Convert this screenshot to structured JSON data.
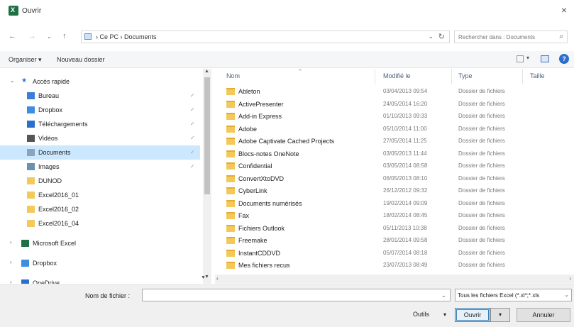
{
  "window": {
    "title": "Ouvrir",
    "close": "×"
  },
  "nav": {
    "back": "←",
    "forward": "→",
    "recent": "⌄",
    "up": "↑",
    "breadcrumb": "›  Ce PC  ›  Documents",
    "address_dropdown": "⌄",
    "refresh": "↻",
    "search_placeholder": "Rechercher dans : Documents",
    "search_icon": "⌕"
  },
  "toolbar": {
    "organize": "Organiser ▾",
    "new_folder": "Nouveau dossier",
    "help": "?"
  },
  "sidebar": {
    "items": [
      {
        "label": "Accès rapide",
        "icon": "star-icon",
        "color": "#2a6fc9",
        "expander": "⌄",
        "pinned": false
      },
      {
        "label": "Bureau",
        "icon": "desktop-icon",
        "color": "#3a7fd5",
        "pinned": true
      },
      {
        "label": "Dropbox",
        "icon": "dropbox-icon",
        "color": "#3d8ee0",
        "pinned": true
      },
      {
        "label": "Téléchargements",
        "icon": "download-icon",
        "color": "#2a6fc9",
        "pinned": true
      },
      {
        "label": "Vidéos",
        "icon": "video-icon",
        "color": "#555555",
        "pinned": true
      },
      {
        "label": "Documents",
        "icon": "documents-icon",
        "color": "#8aa4c0",
        "pinned": true,
        "selected": true
      },
      {
        "label": "Images",
        "icon": "images-icon",
        "color": "#6d8fb0",
        "pinned": true
      },
      {
        "label": "DUNOD",
        "icon": "folder-icon",
        "color": "#f3c95b",
        "pinned": false
      },
      {
        "label": "Excel2016_01",
        "icon": "folder-icon",
        "color": "#f3c95b",
        "pinned": false
      },
      {
        "label": "Excel2016_02",
        "icon": "folder-icon",
        "color": "#f3c95b",
        "pinned": false
      },
      {
        "label": "Excel2016_04",
        "icon": "folder-icon",
        "color": "#f3c95b",
        "pinned": false
      },
      {
        "label": "Microsoft Excel",
        "icon": "excel-icon",
        "color": "#1e7145",
        "expander": "›",
        "pinned": false
      },
      {
        "label": "Dropbox",
        "icon": "dropbox-icon",
        "color": "#3d8ee0",
        "expander": "›",
        "pinned": false
      },
      {
        "label": "OneDrive",
        "icon": "onedrive-icon",
        "color": "#2a6fc9",
        "expander": "›",
        "pinned": false
      }
    ],
    "pin_glyph": "✓"
  },
  "columns": {
    "name": "Nom",
    "modified": "Modifié le",
    "type": "Type",
    "size": "Taille"
  },
  "files": [
    {
      "name": "Ableton",
      "date": "03/04/2013 09:54",
      "type": "Dossier de fichiers"
    },
    {
      "name": "ActivePresenter",
      "date": "24/05/2014 16:20",
      "type": "Dossier de fichiers"
    },
    {
      "name": "Add-in Express",
      "date": "01/10/2013 09:33",
      "type": "Dossier de fichiers"
    },
    {
      "name": "Adobe",
      "date": "05/10/2014 11:00",
      "type": "Dossier de fichiers"
    },
    {
      "name": "Adobe Captivate Cached Projects",
      "date": "27/05/2014 11:25",
      "type": "Dossier de fichiers"
    },
    {
      "name": "Blocs-notes OneNote",
      "date": "03/05/2013 11:44",
      "type": "Dossier de fichiers"
    },
    {
      "name": "Confidential",
      "date": "03/05/2014 08:58",
      "type": "Dossier de fichiers"
    },
    {
      "name": "ConvertXtoDVD",
      "date": "06/05/2013 08:10",
      "type": "Dossier de fichiers"
    },
    {
      "name": "CyberLink",
      "date": "26/12/2012 09:32",
      "type": "Dossier de fichiers"
    },
    {
      "name": "Documents numérisés",
      "date": "19/02/2014 09:09",
      "type": "Dossier de fichiers"
    },
    {
      "name": "Fax",
      "date": "18/02/2014 08:45",
      "type": "Dossier de fichiers"
    },
    {
      "name": "Fichiers Outlook",
      "date": "05/11/2013 10:38",
      "type": "Dossier de fichiers"
    },
    {
      "name": "Freemake",
      "date": "28/01/2014 09:58",
      "type": "Dossier de fichiers"
    },
    {
      "name": "InstantCDDVD",
      "date": "05/07/2014 08:18",
      "type": "Dossier de fichiers"
    },
    {
      "name": "Mes fichiers recus",
      "date": "23/07/2013 08:49",
      "type": "Dossier de fichiers"
    }
  ],
  "footer": {
    "filename_label": "Nom de fichier :",
    "filename_value": "",
    "filter": "Tous les fichiers Excel (*.xl*;*.xls",
    "tools": "Outils",
    "tools_dropdown": "▾",
    "open": "Ouvrir",
    "open_dropdown": "▾",
    "cancel": "Annuler"
  },
  "colors": {
    "accent": "#2a6fc9",
    "selection": "#cce8ff",
    "folder": "#f3c95b",
    "excel": "#1e7145"
  }
}
